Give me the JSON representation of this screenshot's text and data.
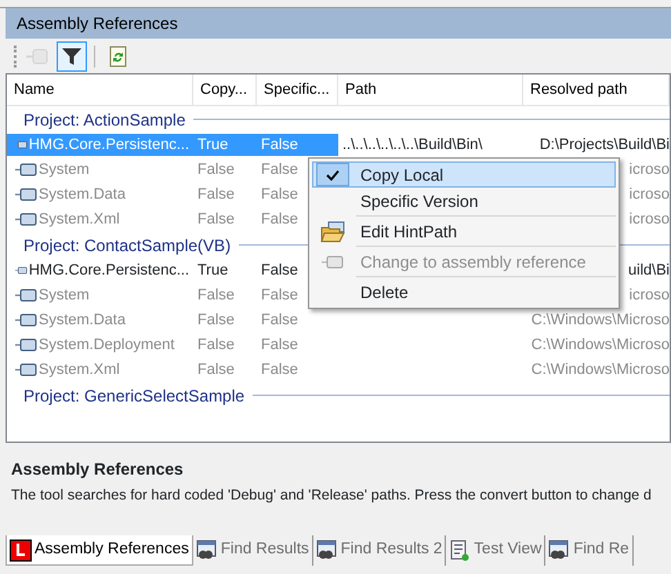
{
  "panel": {
    "title": "Assembly References"
  },
  "toolbar": [
    {
      "kind": "reference",
      "disabled": true,
      "selected": false
    },
    {
      "kind": "filter",
      "disabled": false,
      "selected": true
    },
    {
      "kind": "refresh",
      "disabled": false,
      "selected": false
    }
  ],
  "table": {
    "columns": [
      "Name",
      "Copy...",
      "Specific...",
      "Path",
      "Resolved path"
    ],
    "groups": [
      {
        "title": "Project: ActionSample",
        "rows": [
          {
            "kind": "project",
            "selected": true,
            "cells": [
              "HMG.Core.Persistenc...",
              "True",
              "False",
              "..\\..\\..\\..\\..\\..\\Build\\Bin\\",
              "D:\\Projects\\Build\\Bi"
            ]
          },
          {
            "kind": "framework",
            "selected": false,
            "cells": [
              "System",
              "False",
              "False",
              "",
              "icroso"
            ]
          },
          {
            "kind": "framework",
            "selected": false,
            "cells": [
              "System.Data",
              "False",
              "False",
              "",
              "icroso"
            ]
          },
          {
            "kind": "framework",
            "selected": false,
            "cells": [
              "System.Xml",
              "False",
              "False",
              "",
              "icroso"
            ]
          }
        ]
      },
      {
        "title": "Project: ContactSample(VB)",
        "rows": [
          {
            "kind": "project",
            "selected": false,
            "cells": [
              "HMG.Core.Persistenc...",
              "True",
              "False",
              "",
              "uild\\Bi"
            ]
          },
          {
            "kind": "framework",
            "selected": false,
            "cells": [
              "System",
              "False",
              "False",
              "",
              "icroso"
            ]
          },
          {
            "kind": "framework",
            "selected": false,
            "cells": [
              "System.Data",
              "False",
              "False",
              "",
              "C:\\Windows\\Microso"
            ]
          },
          {
            "kind": "framework",
            "selected": false,
            "cells": [
              "System.Deployment",
              "False",
              "False",
              "",
              "C:\\Windows\\Microso"
            ]
          },
          {
            "kind": "framework",
            "selected": false,
            "cells": [
              "System.Xml",
              "False",
              "False",
              "",
              "C:\\Windows\\Microso"
            ]
          }
        ]
      },
      {
        "title": "Project: GenericSelectSample"
      }
    ]
  },
  "context_menu": [
    {
      "kind": "text",
      "label": "Copy Local",
      "checked": true,
      "selected": true,
      "disabled": false
    },
    {
      "kind": "text",
      "label": "Specific Version",
      "checked": false,
      "selected": false,
      "disabled": false
    },
    {
      "kind": "separator"
    },
    {
      "kind": "folder",
      "label": "Edit HintPath",
      "checked": false,
      "selected": false,
      "disabled": false
    },
    {
      "kind": "separator"
    },
    {
      "kind": "reference",
      "label": "Change to assembly reference",
      "checked": false,
      "selected": false,
      "disabled": true
    },
    {
      "kind": "separator"
    },
    {
      "kind": "text",
      "label": "Delete",
      "checked": false,
      "selected": false,
      "disabled": false
    }
  ],
  "description": {
    "title": "Assembly References",
    "text": "The tool searches for hard coded 'Debug' and 'Release' paths. Press the convert button to change d"
  },
  "bottom_tabs": [
    {
      "kind": "logo",
      "label": "Assembly References",
      "selected": true
    },
    {
      "kind": "find",
      "label": "Find Results",
      "selected": false
    },
    {
      "kind": "find",
      "label": "Find Results 2",
      "selected": false
    },
    {
      "kind": "test",
      "label": "Test View",
      "selected": false
    },
    {
      "kind": "find",
      "label": "Find Re",
      "selected": false
    }
  ]
}
